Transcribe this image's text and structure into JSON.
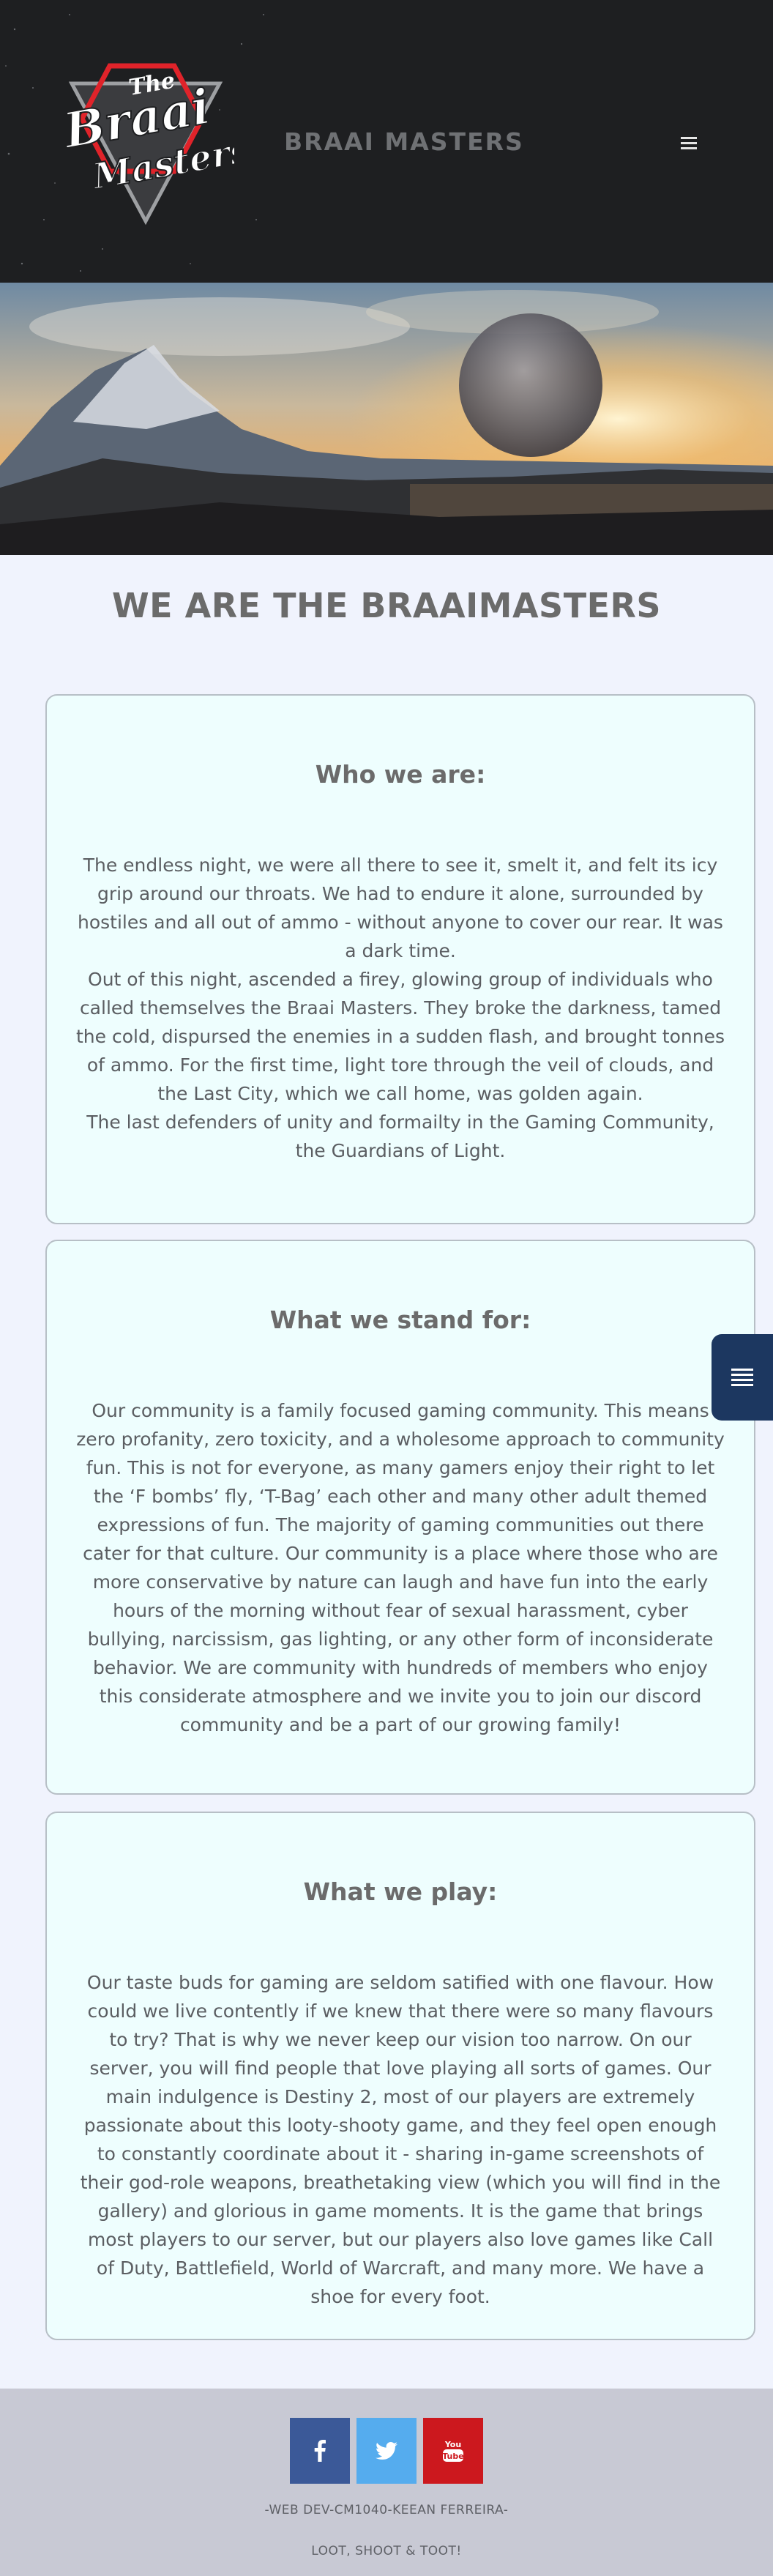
{
  "header": {
    "brand": "BRAAI MASTERS",
    "logo": {
      "line1": "The",
      "line2": "Braai",
      "line3": "Masters"
    },
    "menu_icon": "hamburger-icon"
  },
  "hero": {
    "image": "planet-over-mountain-landscape"
  },
  "page_title": "WE ARE THE BRAAIMASTERS",
  "cards": [
    {
      "title": "Who we are:",
      "paragraphs": [
        "The endless night, we were all there to see it, smelt it, and felt its icy grip around our throats. We had to endure it alone, surrounded by hostiles and all out of ammo - without anyone to cover our rear. It was a dark time.",
        "Out of this night, ascended a firey, glowing group of individuals who called themselves the Braai Masters. They broke the darkness, tamed the cold, dispursed the enemies in a sudden flash, and brought tonnes of ammo. For the first time, light tore through the veil of clouds, and the Last City, which we call home, was golden again.",
        "The last defenders of unity and formailty in the Gaming Community, the Guardians of Light."
      ]
    },
    {
      "title": "What we stand for:",
      "paragraphs": [
        "Our community is a family focused gaming community. This means zero profanity, zero toxicity, and a wholesome approach to community fun. This is not for everyone, as many gamers enjoy their right to let the ‘F bombs’ fly, ‘T-Bag’ each other and many other adult themed expressions of fun. The majority of gaming communities out there cater for that culture. Our community is a place where those who are more conservative by nature can laugh and have fun into the early hours of the morning without fear of sexual harassment, cyber bullying, narcissism, gas lighting, or any other form of inconsiderate behavior. We are community with hundreds of members who enjoy this considerate atmosphere and we invite you to join our discord community and be a part of our growing family!"
      ]
    },
    {
      "title": "What we play:",
      "paragraphs": [
        "Our taste buds for gaming are seldom satified with one flavour. How could we live contently if we knew that there were so many flavours to try? That is why we never keep our vision too narrow. On our server, you will find people that love playing all sorts of games. Our main indulgence is Destiny 2, most of our players are extremely passionate about this looty-shooty game, and they feel open enough to constantly coordinate about it - sharing in-game screenshots of their god-role weapons, breathetaking view (which you will find in the gallery) and glorious in game moments. It is the game that brings most players to our server, but our players also love games like Call of Duty, Battlefield, World of Warcraft, and many more. We have a shoe for every foot."
      ]
    }
  ],
  "side_tab": {
    "icon": "list-icon"
  },
  "footer": {
    "social": [
      {
        "name": "facebook",
        "icon": "f",
        "color": "#3b5998"
      },
      {
        "name": "twitter",
        "icon": "twitter-bird-icon",
        "color": "#55acee"
      },
      {
        "name": "youtube",
        "icon": "youtube-icon",
        "color": "#cc181e"
      }
    ],
    "credit": "-WEB DEV-CM1040-KEEAN FERREIRA-",
    "tagline": "LOOT, SHOOT & TOOT!"
  },
  "colors": {
    "header_bg": "#1e1f21",
    "page_bg": "#f0f3fd",
    "card_bg": "#eefefe",
    "side_tab": "#1c3760",
    "footer_bg": "#c8c9d4",
    "logo_red": "#e0232a"
  }
}
